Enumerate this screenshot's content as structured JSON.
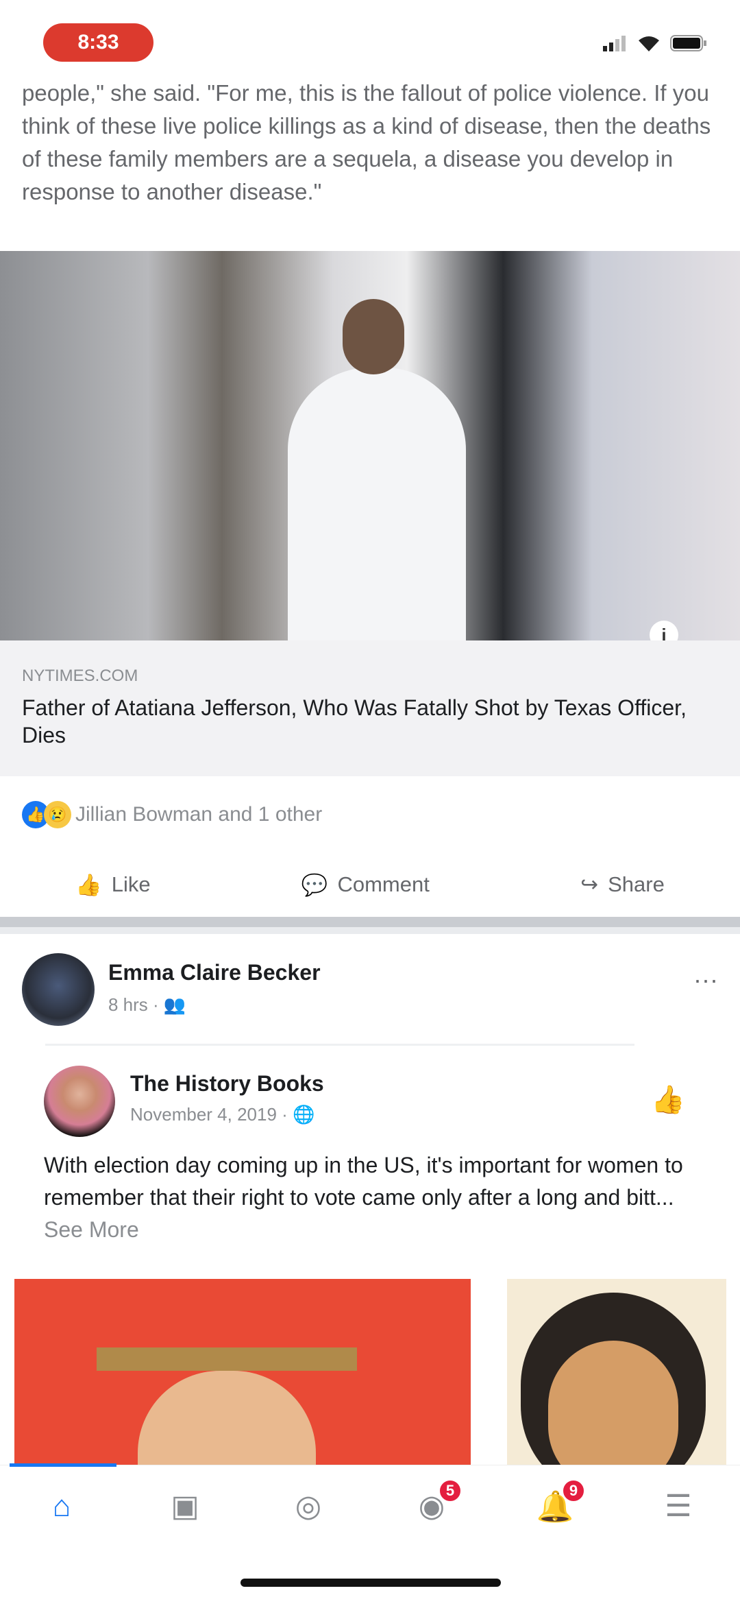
{
  "status_bar": {
    "time": "8:33"
  },
  "previous_post": {
    "quote": "people,\" she said. \"For me, this is the fallout of police violence. If you think of these live police killings as a kind of disease, then the deaths of these family members are a sequela, a disease you develop in response to another disease.\"",
    "link": {
      "domain": "nytimes.com",
      "title": "Father of Atatiana Jefferson, Who Was Fatally Shot by Texas Officer, Dies"
    },
    "reactions": "Jillian Bowman and 1 other",
    "actions": {
      "like": "Like",
      "comment": "Comment",
      "share": "Share"
    }
  },
  "post": {
    "author": "Emma Claire Becker",
    "time": "8 hrs",
    "shared": {
      "page": "The History Books",
      "date": "November 4, 2019",
      "text": "With election day coming up in the US, it's important for women to remember that their right to vote came only after a long and bitt...",
      "see_more": "See More"
    }
  },
  "nav": {
    "watch_badge": "",
    "groups_badge": "5",
    "notifications_badge": "9"
  },
  "colors": {
    "accent": "#1877f2",
    "badge": "#e41e3f",
    "pill": "#dc3a2e"
  }
}
